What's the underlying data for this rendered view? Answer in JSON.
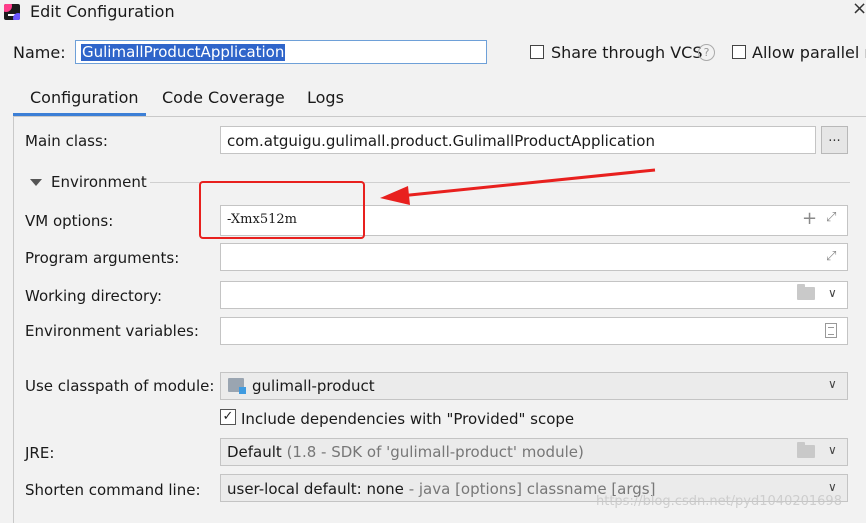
{
  "window": {
    "title": "Edit Configuration",
    "close_glyph": "×"
  },
  "name_row": {
    "label": "Name:",
    "value": "GulimallProductApplication",
    "share_label": "Share through VCS",
    "help_glyph": "?",
    "parallel_label": "Allow parallel ru"
  },
  "tabs": [
    {
      "label": "Configuration",
      "active": true
    },
    {
      "label": "Code Coverage"
    },
    {
      "label": "Logs"
    }
  ],
  "main_class": {
    "label": "Main class:",
    "value": "com.atguigu.gulimall.product.GulimallProductApplication",
    "browse_label": "..."
  },
  "environment": {
    "section_label": "Environment",
    "vm_options": {
      "label": "VM options:",
      "value": "-Xmx512m"
    },
    "program_arguments": {
      "label": "Program arguments:",
      "value": ""
    },
    "working_directory": {
      "label": "Working directory:",
      "value": ""
    },
    "environment_variables": {
      "label": "Environment variables:",
      "value": ""
    }
  },
  "module": {
    "label": "Use classpath of module:",
    "value": "gulimall-product",
    "include_label": "Include dependencies with \"Provided\" scope",
    "include_checked": true
  },
  "jre": {
    "label": "JRE:",
    "value": "Default",
    "detail": " (1.8 - SDK of 'gulimall-product' module)"
  },
  "shorten": {
    "label": "Shorten command line:",
    "value": "user-local default: none",
    "detail": " - java [options] classname [args]"
  },
  "watermark": "https://blog.csdn.net/pyd1040201698",
  "icons": {
    "app": "intellij-app-icon",
    "help": "help-icon",
    "plus": "plus-icon",
    "expand": "expand-icon",
    "folder": "folder-icon",
    "chevron": "chevron-down-icon",
    "doc": "document-icon",
    "module": "module-icon"
  },
  "colors": {
    "accent": "#3c7fd6",
    "selection": "#2f65ca",
    "annotation": "#e8201e"
  }
}
